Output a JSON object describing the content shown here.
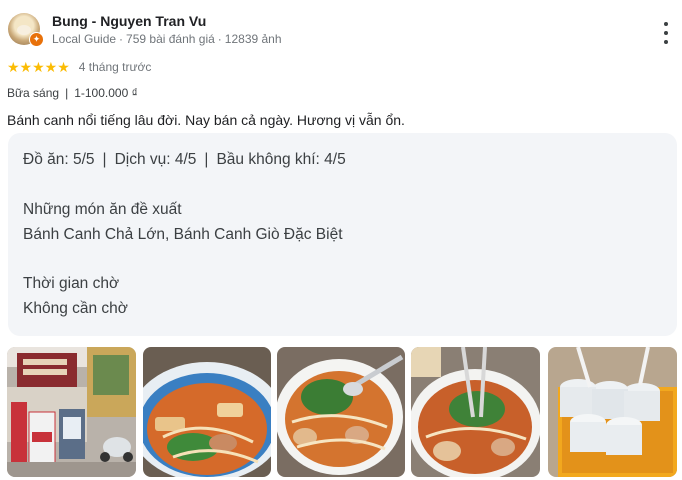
{
  "reviewer": {
    "name": "Bung - Nguyen Tran Vu",
    "level": "Local Guide",
    "reviews": "759 bài đánh giá",
    "photos": "12839 ảnh"
  },
  "rating": {
    "stars": 5,
    "max": 5,
    "stars_text": "★★★★★",
    "time_ago": "4 tháng trước"
  },
  "meal": {
    "type": "Bữa sáng",
    "price": "1-100.000 ₫"
  },
  "review_text": "Bánh canh nổi tiếng lâu đời. Nay bán cả ngày. Hương vị vẫn ổn.",
  "details": {
    "food": "Đồ ăn: 5/5",
    "service": "Dịch vụ: 4/5",
    "atmosphere": "Bầu không khí: 4/5",
    "separator": "|",
    "recommended_label": "Những món ăn đề xuất",
    "recommended_value": "Bánh Canh Chả Lớn, Bánh Canh Giò Đặc Biệt",
    "wait_label": "Thời gian chờ",
    "wait_value": "Không cần chờ"
  },
  "photos": [
    {
      "icon": "storefront-photo"
    },
    {
      "icon": "noodle-soup-photo"
    },
    {
      "icon": "noodle-soup-photo"
    },
    {
      "icon": "noodle-soup-photo"
    },
    {
      "icon": "drink-cups-photo"
    }
  ],
  "colors": {
    "star": "#fbbc04",
    "badge": "#e8710a",
    "details_bg": "#f3f5f8"
  }
}
